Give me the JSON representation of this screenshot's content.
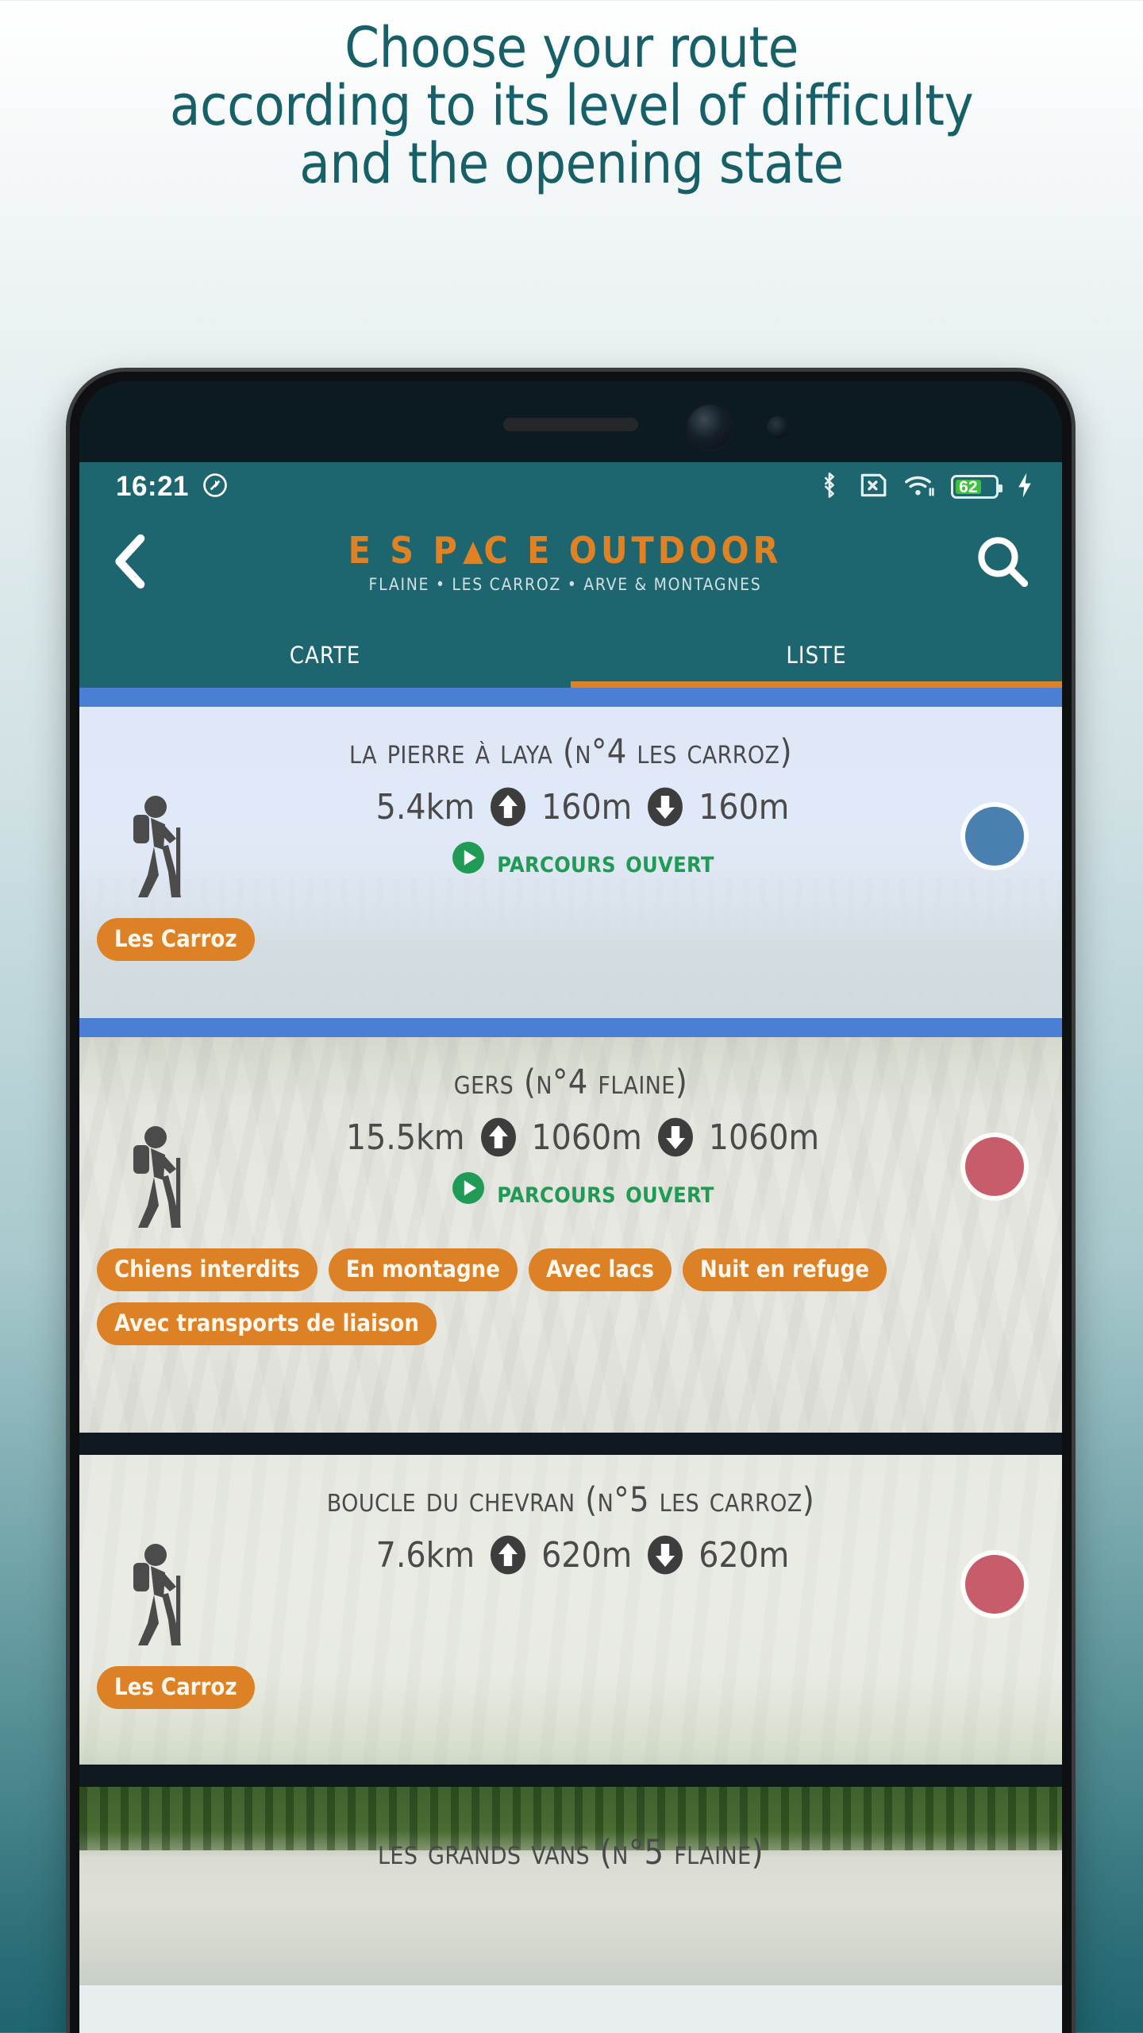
{
  "headline": {
    "line1": "Choose your route",
    "line2": "according to its level of difficulty",
    "line3": "and the opening state",
    "color": "#176068"
  },
  "status_bar": {
    "time": "16:21",
    "rotation_lock_icon": "rotation-lock-icon",
    "bluetooth_icon": "bluetooth-icon",
    "no_sim_icon": "no-sim-icon",
    "wifi_icon": "wifi-icon",
    "battery_level": "62",
    "battery_color": "#3fc13f",
    "charging_icon": "charging-bolt-icon"
  },
  "app_header": {
    "back_icon": "back-chevron-icon",
    "search_icon": "search-icon",
    "logo_part1": "E S P",
    "logo_part2": "C E OUTDOOR",
    "logo_full": "E S PΔC E OUTDOOR",
    "logo_subtitle": "FLAINE • LES CARROZ • ARVE & MONTAGNES",
    "brand_orange": "#e08124",
    "brand_teal": "#1d6670"
  },
  "tabs": [
    {
      "label": "Carte",
      "active": false
    },
    {
      "label": "Liste",
      "active": true
    }
  ],
  "routes": [
    {
      "title": "La Pierre à Laya (n°4 Les Carroz)",
      "distance": "5.4km",
      "ascent": "160m",
      "descent": "160m",
      "status": "Parcours ouvert",
      "status_icon": "play-circle-icon",
      "activity_icon": "hiker-icon",
      "difficulty_color": "#4a80b0",
      "tags": [
        "Les Carroz"
      ]
    },
    {
      "title": "Gers (n°4 Flaine)",
      "distance": "15.5km",
      "ascent": "1060m",
      "descent": "1060m",
      "status": "Parcours ouvert",
      "status_icon": "play-circle-icon",
      "activity_icon": "hiker-icon",
      "difficulty_color": "#c75c6b",
      "tags": [
        "Chiens interdits",
        "En montagne",
        "Avec lacs",
        "Nuit en refuge",
        "Avec transports de liaison"
      ]
    },
    {
      "title": "Boucle du Chevran (n°5 Les Carroz)",
      "distance": "7.6km",
      "ascent": "620m",
      "descent": "620m",
      "status": "",
      "status_icon": "",
      "activity_icon": "hiker-icon",
      "difficulty_color": "#c75c6b",
      "tags": [
        "Les Carroz"
      ]
    },
    {
      "title": "Les Grands Vans (n°5 Flaine)",
      "distance": "",
      "ascent": "",
      "descent": "",
      "status": "",
      "status_icon": "",
      "activity_icon": "hiker-icon",
      "difficulty_color": "",
      "tags": []
    }
  ]
}
